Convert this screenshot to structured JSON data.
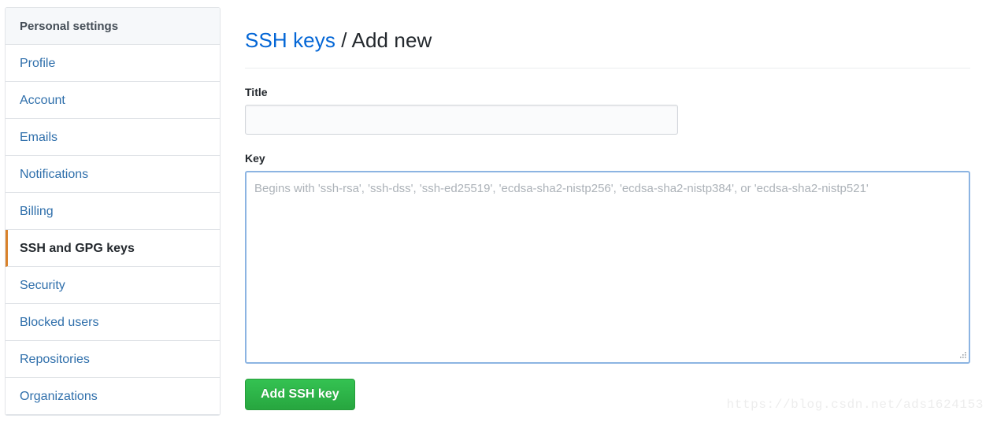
{
  "sidebar": {
    "header": "Personal settings",
    "items": [
      {
        "label": "Profile",
        "active": false
      },
      {
        "label": "Account",
        "active": false
      },
      {
        "label": "Emails",
        "active": false
      },
      {
        "label": "Notifications",
        "active": false
      },
      {
        "label": "Billing",
        "active": false
      },
      {
        "label": "SSH and GPG keys",
        "active": true
      },
      {
        "label": "Security",
        "active": false
      },
      {
        "label": "Blocked users",
        "active": false
      },
      {
        "label": "Repositories",
        "active": false
      },
      {
        "label": "Organizations",
        "active": false
      }
    ],
    "active_accent_color": "#d9822b",
    "link_color": "#2f6fab",
    "header_bg": "#f6f8fa"
  },
  "heading": {
    "link_text": "SSH keys",
    "separator": " / ",
    "current": "Add new",
    "link_color": "#0366d6"
  },
  "form": {
    "title": {
      "label": "Title",
      "value": "",
      "placeholder": ""
    },
    "key": {
      "label": "Key",
      "value": "",
      "placeholder": "Begins with 'ssh-rsa', 'ssh-dss', 'ssh-ed25519', 'ecdsa-sha2-nistp256', 'ecdsa-sha2-nistp384', or 'ecdsa-sha2-nistp521'",
      "focus_border_color": "#8cb4e2"
    },
    "submit_label": "Add SSH key",
    "submit_color": "#2ca441"
  },
  "watermark": {
    "text": "https://blog.csdn.net/ads1624153"
  }
}
